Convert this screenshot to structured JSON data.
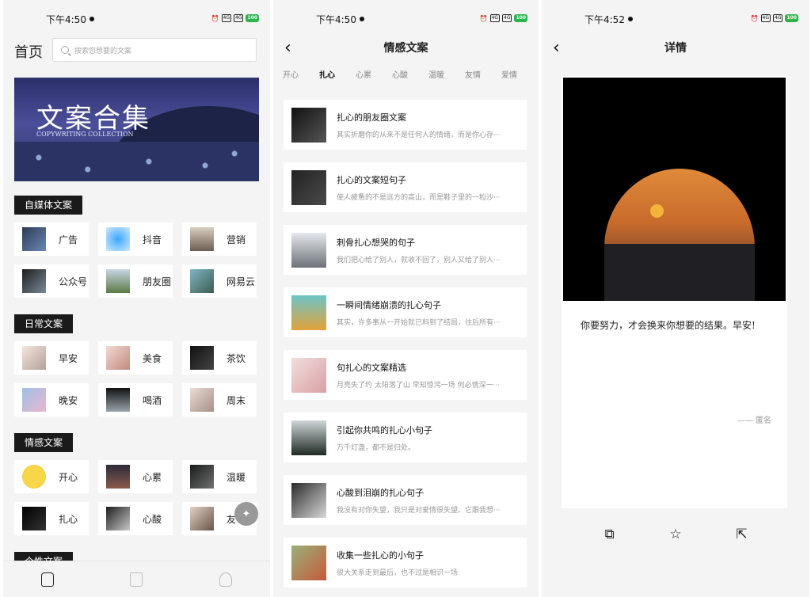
{
  "screen1": {
    "time": "下午4:50",
    "title": "首页",
    "search_placeholder": "搜索您想要的文案",
    "banner_title": "文案合集",
    "banner_subtitle": "COPYWRITING COLLECTION",
    "sections": [
      {
        "label": "自媒体文案",
        "items": [
          "广告",
          "抖音",
          "营销",
          "公众号",
          "朋友圈",
          "网易云"
        ]
      },
      {
        "label": "日常文案",
        "items": [
          "早安",
          "美食",
          "茶饮",
          "晚安",
          "喝酒",
          "周末"
        ]
      },
      {
        "label": "情感文案",
        "items": [
          "开心",
          "心累",
          "温暖",
          "扎心",
          "心酸",
          "友"
        ]
      }
    ],
    "next_section_partial": "个性文案",
    "nav": [
      "home-icon",
      "document-icon",
      "profile-icon"
    ]
  },
  "screen2": {
    "time": "下午4:50",
    "title": "情感文案",
    "tabs": [
      "开心",
      "扎心",
      "心累",
      "心酸",
      "温暖",
      "友情",
      "爱情"
    ],
    "active_tab": "扎心",
    "cards": [
      {
        "title": "扎心的朋友圈文案",
        "snippet": "其实折磨你的从来不是任何人的情绪，而是你心存···"
      },
      {
        "title": "扎心的文案短句子",
        "snippet": "使人疲惫的不是远方的高山，而是鞋子里的一粒沙···"
      },
      {
        "title": "刺骨扎心想哭的句子",
        "snippet": "我们把心给了别人，就收不回了，别人又给了别人···"
      },
      {
        "title": "一瞬间情绪崩溃的扎心句子",
        "snippet": "其实，许多事从一开始就已料到了结局，往后所有···"
      },
      {
        "title": "句扎心的文案精选",
        "snippet": "月亮失了约 太阳落了山 早知惊鸿一场 何必情深一···"
      },
      {
        "title": "引起你共鸣的扎心小句子",
        "snippet": "万千灯盏，都不是归处。"
      },
      {
        "title": "心酸到泪崩的扎心句子",
        "snippet": "我没有对你失望，我只是对爱情很失望。它跟我想···"
      },
      {
        "title": "收集一些扎心的小句子",
        "snippet": "很大关系走到最后，也不过是相识一场"
      }
    ]
  },
  "screen3": {
    "time": "下午4:52",
    "title": "详情",
    "quote": "你要努力，才会换来你想要的结果。早安!",
    "author": "—— 匿名",
    "actions": [
      "copy-icon",
      "star-icon",
      "share-icon"
    ]
  },
  "status_bar": {
    "battery": "100",
    "network": "4G"
  },
  "colors": {
    "background": "#f4f4f4",
    "label_bg": "#1a1a1a",
    "card_bg": "#ffffff",
    "battery": "#2db34a"
  }
}
